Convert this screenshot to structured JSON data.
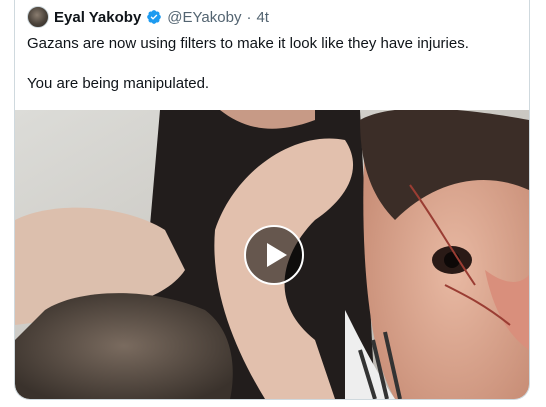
{
  "tweet": {
    "author_name": "Eyal Yakoby",
    "handle": "@EYakoby",
    "separator": "·",
    "time": "4t",
    "text_lines": [
      "Gazans are now using filters to make it look like they have injuries.",
      "You are being manipulated."
    ],
    "verified_icon": "verified-badge-icon",
    "verified_color": "#1d9bf0"
  },
  "media": {
    "type": "video",
    "play_icon": "play-icon"
  }
}
